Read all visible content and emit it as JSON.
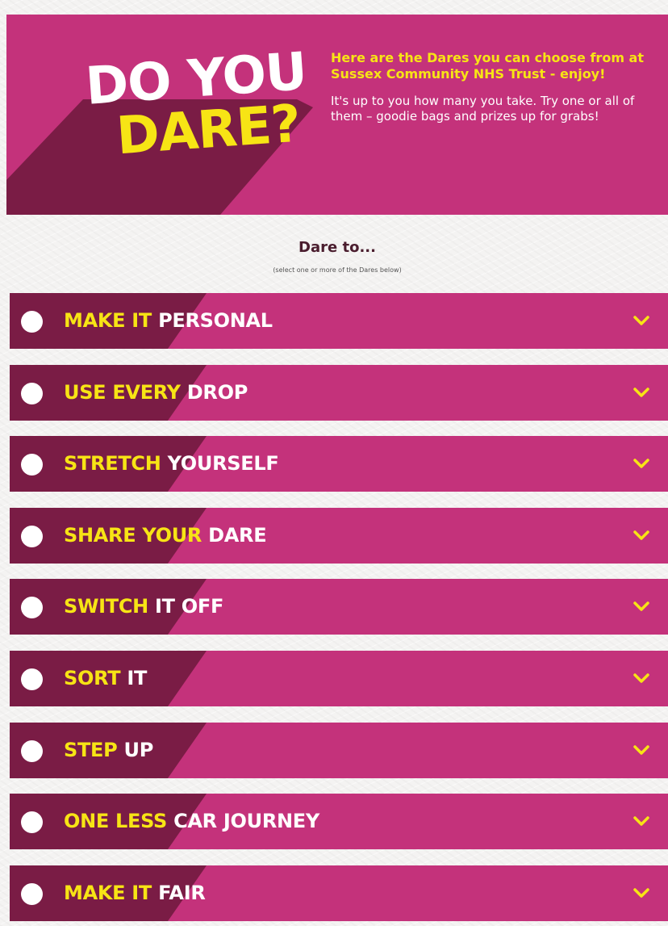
{
  "header": {
    "logo_line1": "DO YOU",
    "logo_line2": "DARE?",
    "intro_heading": "Here are the Dares you can choose from at Sussex Community NHS Trust - enjoy!",
    "intro_body": "It's up to you how many you take. Try one or all of them – goodie bags and prizes up for grabs!"
  },
  "section": {
    "title": "Dare to...",
    "subtitle": "(select one or more of the Dares below)"
  },
  "dares": [
    {
      "highlight": "MAKE IT",
      "rest": "PERSONAL",
      "selected": false
    },
    {
      "highlight": "USE EVERY",
      "rest": "DROP",
      "selected": false
    },
    {
      "highlight": "STRETCH",
      "rest": "YOURSELF",
      "selected": false
    },
    {
      "highlight": "SHARE YOUR",
      "rest": "DARE",
      "selected": false
    },
    {
      "highlight": "SWITCH",
      "rest": "IT OFF",
      "selected": false
    },
    {
      "highlight": "SORT",
      "rest": "IT",
      "selected": false
    },
    {
      "highlight": "STEP",
      "rest": "UP",
      "selected": false
    },
    {
      "highlight": "ONE LESS",
      "rest": "CAR JOURNEY",
      "selected": false
    },
    {
      "highlight": "MAKE IT",
      "rest": "FAIR",
      "selected": false
    }
  ],
  "icons": {
    "radio": "radio-unchecked-icon",
    "expand": "chevron-down-icon"
  },
  "colors": {
    "brand_pink": "#c4327b",
    "shadow_plum": "#7a1c45",
    "highlight_yellow": "#f7e415",
    "text_white": "#ffffff",
    "heading_dark": "#4a1d2e"
  }
}
